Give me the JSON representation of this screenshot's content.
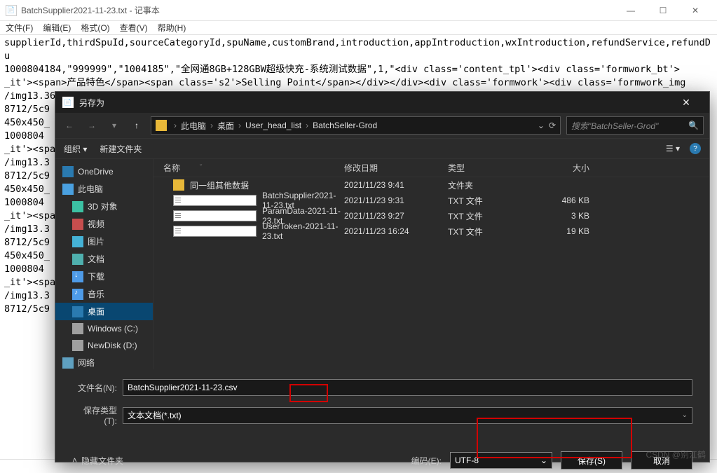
{
  "notepad": {
    "title": "BatchSupplier2021-11-23.txt - 记事本",
    "menu": [
      "文件(F)",
      "编辑(E)",
      "格式(O)",
      "查看(V)",
      "帮助(H)"
    ],
    "content": "supplierId,thirdSpuId,sourceCategoryId,spuName,customBrand,introduction,appIntroduction,wxIntroduction,refundService,refundDu\n1000804184,\"999999\",\"1004185\",\"全网通8GB+128GBW超级快充-系统测试数据\",1,\"<div class='content_tpl'><div class='formwork_bt'>\n_it'><span>产品特色</span><span class='s2'>Selling Point</span></div></div><div class='formwork'><div class='formwork_img\n/img13.360buyimg.com/n1/s450x450_jfs/t1/22451/28/12710/368712/5c98cb73Ed43393bd/7e45d0bb0b33f566.jpg\",\"http://img13.360\n8712/5c9\n450x450_\n1000804\n_it'><spa\n/img13.3\n8712/5c9\n450x450_\n1000804\n_it'><spa\n/img13.3\n8712/5c9\n450x450_\n1000804\n_it'><spa\n/img13.3\n8712/5c9"
  },
  "dialog": {
    "title": "另存为",
    "breadcrumb": [
      "此电脑",
      "桌面",
      "User_head_list",
      "BatchSeller-Grod"
    ],
    "search_placeholder": "搜索\"BatchSeller-Grod\"",
    "toolbar": {
      "organize": "组织 ▾",
      "newfolder": "新建文件夹"
    },
    "tree": [
      {
        "icon": "onedrive",
        "label": "OneDrive",
        "indent": false
      },
      {
        "icon": "pc",
        "label": "此电脑",
        "indent": false
      },
      {
        "icon": "obj3d",
        "label": "3D 对象",
        "indent": true
      },
      {
        "icon": "video",
        "label": "视频",
        "indent": true
      },
      {
        "icon": "pic",
        "label": "图片",
        "indent": true
      },
      {
        "icon": "doc",
        "label": "文档",
        "indent": true
      },
      {
        "icon": "dl",
        "label": "下载",
        "indent": true
      },
      {
        "icon": "music",
        "label": "音乐",
        "indent": true
      },
      {
        "icon": "desktop",
        "label": "桌面",
        "indent": true,
        "sel": true
      },
      {
        "icon": "drive",
        "label": "Windows (C:)",
        "indent": true
      },
      {
        "icon": "drive",
        "label": "NewDisk (D:)",
        "indent": true
      },
      {
        "icon": "net",
        "label": "网络",
        "indent": false
      }
    ],
    "columns": {
      "name": "名称",
      "date": "修改日期",
      "type": "类型",
      "size": "大小"
    },
    "files": [
      {
        "icon": "folder",
        "name": "同一组其他数据",
        "date": "2021/11/23 9:41",
        "type": "文件夹",
        "size": ""
      },
      {
        "icon": "txt",
        "name": "BatchSupplier2021-11-23.txt",
        "date": "2021/11/23 9:31",
        "type": "TXT 文件",
        "size": "486 KB"
      },
      {
        "icon": "txt",
        "name": "ParamData-2021-11-23.txt",
        "date": "2021/11/23 9:27",
        "type": "TXT 文件",
        "size": "3 KB"
      },
      {
        "icon": "txt",
        "name": "UserToken-2021-11-23.txt",
        "date": "2021/11/23 16:24",
        "type": "TXT 文件",
        "size": "19 KB"
      }
    ],
    "filename_label": "文件名(N):",
    "filename_value": "BatchSupplier2021-11-23.csv",
    "filetype_label": "保存类型(T):",
    "filetype_value": "文本文档(*.txt)",
    "hide_folders": "隐藏文件夹",
    "encoding_label": "编码(E):",
    "encoding_value": "UTF-8",
    "save_btn": "保存(S)",
    "cancel_btn": "取消"
  },
  "watermark": "CSDN @别江鹤"
}
